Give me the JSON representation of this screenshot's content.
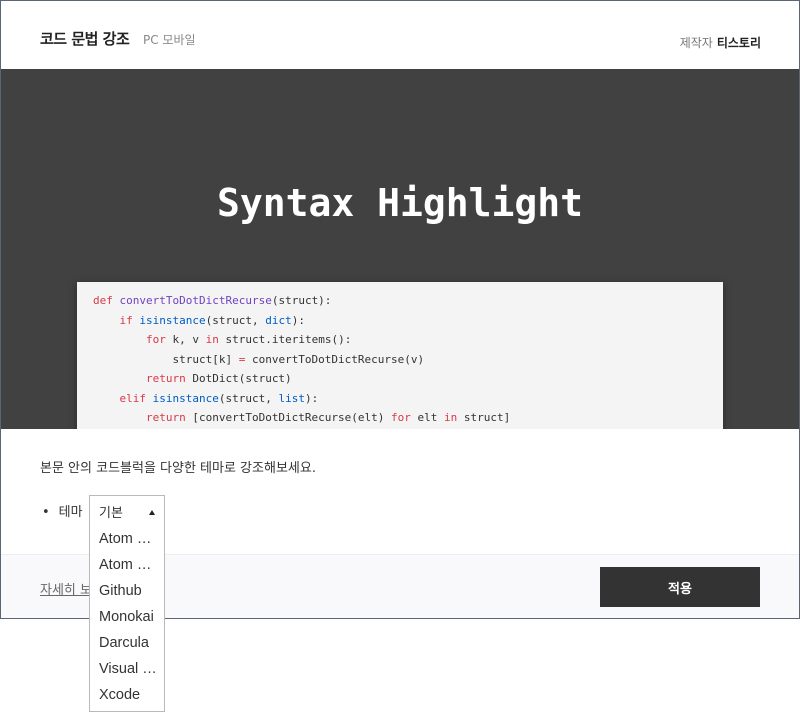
{
  "header": {
    "title": "코드 문법 강조",
    "tag": "PC 모바일",
    "maker_label": "제작자",
    "maker_name": "티스토리"
  },
  "hero": {
    "title": "Syntax Highlight",
    "code_lines": [
      [
        {
          "t": "def ",
          "c": "kw"
        },
        {
          "t": "convertToDotDictRecurse",
          "c": "fn"
        },
        {
          "t": "(struct):",
          "c": ""
        }
      ],
      [
        {
          "t": "    ",
          "c": ""
        },
        {
          "t": "if ",
          "c": "kw"
        },
        {
          "t": "isinstance",
          "c": "bi"
        },
        {
          "t": "(struct, ",
          "c": ""
        },
        {
          "t": "dict",
          "c": "bi"
        },
        {
          "t": "):",
          "c": ""
        }
      ],
      [
        {
          "t": "        ",
          "c": ""
        },
        {
          "t": "for ",
          "c": "kw"
        },
        {
          "t": "k, v ",
          "c": ""
        },
        {
          "t": "in ",
          "c": "kw"
        },
        {
          "t": "struct.iteritems():",
          "c": ""
        }
      ],
      [
        {
          "t": "            struct[k] ",
          "c": ""
        },
        {
          "t": "= ",
          "c": "kw"
        },
        {
          "t": "convertToDotDictRecurse(v)",
          "c": ""
        }
      ],
      [
        {
          "t": "        ",
          "c": ""
        },
        {
          "t": "return ",
          "c": "kw"
        },
        {
          "t": "DotDict(struct)",
          "c": ""
        }
      ],
      [
        {
          "t": "    ",
          "c": ""
        },
        {
          "t": "elif ",
          "c": "kw"
        },
        {
          "t": "isinstance",
          "c": "bi"
        },
        {
          "t": "(struct, ",
          "c": ""
        },
        {
          "t": "list",
          "c": "bi"
        },
        {
          "t": "):",
          "c": ""
        }
      ],
      [
        {
          "t": "        ",
          "c": ""
        },
        {
          "t": "return ",
          "c": "kw"
        },
        {
          "t": "[convertToDotDictRecurse(elt) ",
          "c": ""
        },
        {
          "t": "for ",
          "c": "kw"
        },
        {
          "t": "elt ",
          "c": ""
        },
        {
          "t": "in ",
          "c": "kw"
        },
        {
          "t": "struct]",
          "c": ""
        }
      ]
    ]
  },
  "body": {
    "description": "본문 안의 코드블럭을 다양한 테마로 강조해보세요.",
    "bullet_dot": "•",
    "theme_label": "테마"
  },
  "theme_select": {
    "selected": "기본",
    "options": [
      "Atom One Dark",
      "Atom One Light",
      "Github",
      "Monokai",
      "Darcula",
      "Visual Studio",
      "Xcode"
    ]
  },
  "footer": {
    "detail_link": "자세히 보기",
    "apply_label": "적용"
  },
  "colors": {
    "hero_bg": "#414141",
    "apply_bg": "#333333",
    "keyword": "#d73a49",
    "function": "#6f42c1",
    "builtin": "#005cc5"
  }
}
